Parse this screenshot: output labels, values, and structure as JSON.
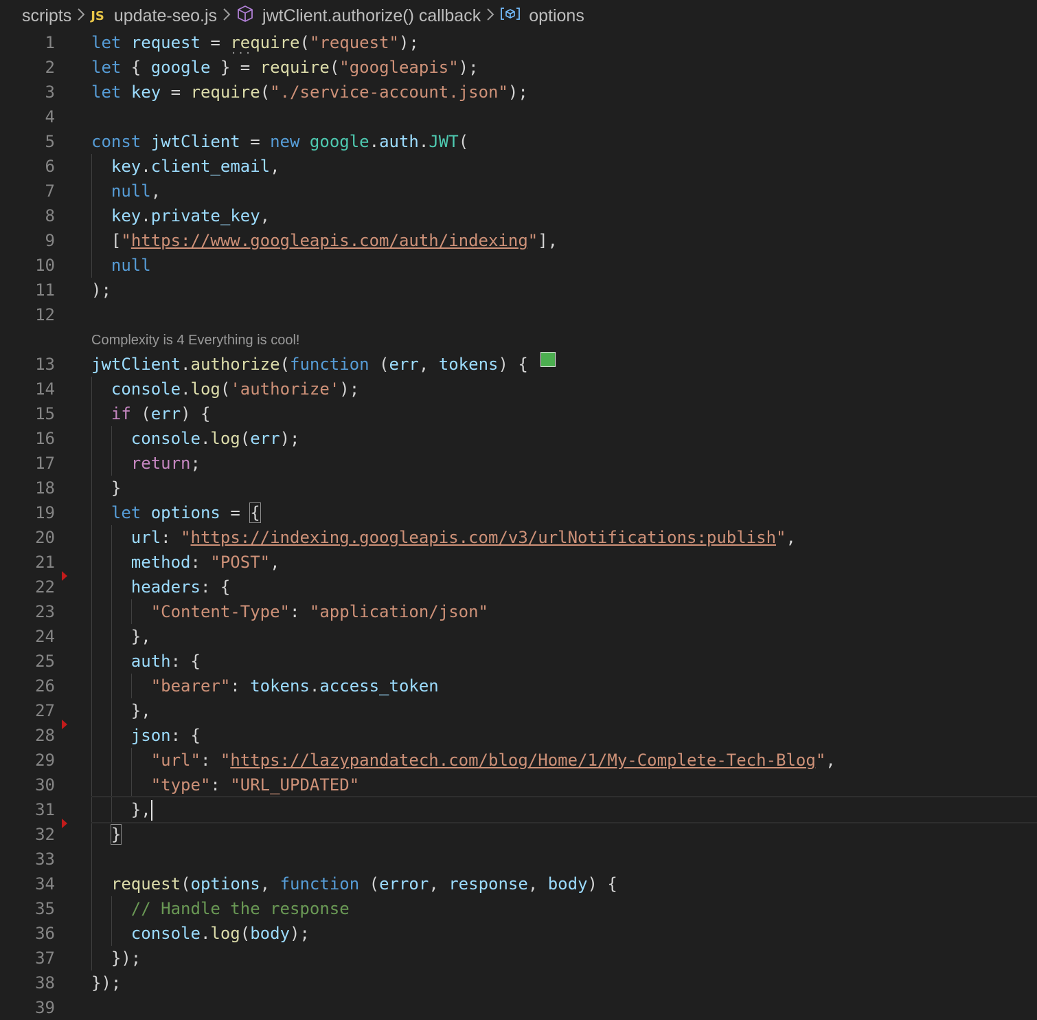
{
  "breadcrumb": {
    "folder": "scripts",
    "file": "update-seo.js",
    "file_icon": "JS",
    "scope": "jwtClient.authorize() callback",
    "symbol": "options"
  },
  "codelens": "Complexity is 4 Everything is cool!",
  "line_numbers": [
    "1",
    "2",
    "3",
    "4",
    "5",
    "6",
    "7",
    "8",
    "9",
    "10",
    "11",
    "12",
    "13",
    "14",
    "15",
    "16",
    "17",
    "18",
    "19",
    "20",
    "21",
    "22",
    "23",
    "24",
    "25",
    "26",
    "27",
    "28",
    "29",
    "30",
    "31",
    "32",
    "33",
    "34",
    "35",
    "36",
    "37",
    "38",
    "39"
  ],
  "colors": {
    "background": "#1f1f1f",
    "keyword": "#569cd6",
    "control": "#c586c0",
    "variable": "#9cdcfe",
    "function": "#dcdcaa",
    "class": "#4ec9b0",
    "string": "#ce9178",
    "comment": "#6a9955",
    "breakpoint_marker": "#c21b1b",
    "complexity_ok": "#4caf50"
  },
  "code": {
    "l1": [
      [
        "let",
        "kw"
      ],
      [
        " ",
        "pun"
      ],
      [
        "request",
        "var"
      ],
      [
        " = ",
        "pun"
      ],
      [
        "require",
        "fn"
      ],
      [
        "(",
        "pun"
      ],
      [
        "\"request\"",
        "str"
      ],
      [
        ");",
        "pun"
      ]
    ],
    "l2": [
      [
        "let",
        "kw"
      ],
      [
        " { ",
        "pun"
      ],
      [
        "google",
        "var"
      ],
      [
        " } = ",
        "pun"
      ],
      [
        "require",
        "fn"
      ],
      [
        "(",
        "pun"
      ],
      [
        "\"googleapis\"",
        "str"
      ],
      [
        ");",
        "pun"
      ]
    ],
    "l3": [
      [
        "let",
        "kw"
      ],
      [
        " ",
        "pun"
      ],
      [
        "key",
        "var"
      ],
      [
        " = ",
        "pun"
      ],
      [
        "require",
        "fn"
      ],
      [
        "(",
        "pun"
      ],
      [
        "\"./service-account.json\"",
        "str"
      ],
      [
        ");",
        "pun"
      ]
    ],
    "l4": [],
    "l5": [
      [
        "const",
        "kw"
      ],
      [
        " ",
        "pun"
      ],
      [
        "jwtClient",
        "var"
      ],
      [
        " = ",
        "pun"
      ],
      [
        "new",
        "kw"
      ],
      [
        " ",
        "pun"
      ],
      [
        "google",
        "cls"
      ],
      [
        ".",
        "pun"
      ],
      [
        "auth",
        "var"
      ],
      [
        ".",
        "pun"
      ],
      [
        "JWT",
        "cls"
      ],
      [
        "(",
        "pun"
      ]
    ],
    "l6": [
      [
        "  ",
        "pun"
      ],
      [
        "key",
        "var"
      ],
      [
        ".",
        "pun"
      ],
      [
        "client_email",
        "var"
      ],
      [
        ",",
        "pun"
      ]
    ],
    "l7": [
      [
        "  ",
        "pun"
      ],
      [
        "null",
        "kw"
      ],
      [
        ",",
        "pun"
      ]
    ],
    "l8": [
      [
        "  ",
        "pun"
      ],
      [
        "key",
        "var"
      ],
      [
        ".",
        "pun"
      ],
      [
        "private_key",
        "var"
      ],
      [
        ",",
        "pun"
      ]
    ],
    "l9": [
      [
        "  [",
        "pun"
      ],
      [
        "\"",
        "str"
      ],
      [
        "https://www.googleapis.com/auth/indexing",
        "url"
      ],
      [
        "\"",
        "str"
      ],
      [
        "],",
        "pun"
      ]
    ],
    "l10": [
      [
        "  ",
        "pun"
      ],
      [
        "null",
        "kw"
      ]
    ],
    "l11": [
      [
        ");",
        "pun"
      ]
    ],
    "l12": [],
    "l13": [
      [
        "jwtClient",
        "var"
      ],
      [
        ".",
        "pun"
      ],
      [
        "authorize",
        "fn"
      ],
      [
        "(",
        "pun"
      ],
      [
        "function",
        "kw"
      ],
      [
        " (",
        "pun"
      ],
      [
        "err",
        "var"
      ],
      [
        ", ",
        "pun"
      ],
      [
        "tokens",
        "var"
      ],
      [
        ") {",
        "pun"
      ]
    ],
    "l14": [
      [
        "  ",
        "pun"
      ],
      [
        "console",
        "var"
      ],
      [
        ".",
        "pun"
      ],
      [
        "log",
        "fn"
      ],
      [
        "(",
        "pun"
      ],
      [
        "'authorize'",
        "str"
      ],
      [
        ");",
        "pun"
      ]
    ],
    "l15": [
      [
        "  ",
        "pun"
      ],
      [
        "if",
        "ctl"
      ],
      [
        " (",
        "pun"
      ],
      [
        "err",
        "var"
      ],
      [
        ") {",
        "pun"
      ]
    ],
    "l16": [
      [
        "    ",
        "pun"
      ],
      [
        "console",
        "var"
      ],
      [
        ".",
        "pun"
      ],
      [
        "log",
        "fn"
      ],
      [
        "(",
        "pun"
      ],
      [
        "err",
        "var"
      ],
      [
        ");",
        "pun"
      ]
    ],
    "l17": [
      [
        "    ",
        "pun"
      ],
      [
        "return",
        "ctl"
      ],
      [
        ";",
        "pun"
      ]
    ],
    "l18": [
      [
        "  }",
        "pun"
      ]
    ],
    "l19": [
      [
        "  ",
        "pun"
      ],
      [
        "let",
        "kw"
      ],
      [
        " ",
        "pun"
      ],
      [
        "options",
        "var"
      ],
      [
        " = ",
        "pun"
      ]
    ],
    "l20": [
      [
        "    ",
        "pun"
      ],
      [
        "url",
        "var"
      ],
      [
        ": ",
        "pun"
      ],
      [
        "\"",
        "str"
      ],
      [
        "https://indexing.googleapis.com/v3/urlNotifications:publish",
        "url"
      ],
      [
        "\"",
        "str"
      ],
      [
        ",",
        "pun"
      ]
    ],
    "l21": [
      [
        "    ",
        "pun"
      ],
      [
        "method",
        "var"
      ],
      [
        ": ",
        "pun"
      ],
      [
        "\"POST\"",
        "str"
      ],
      [
        ",",
        "pun"
      ]
    ],
    "l22": [
      [
        "    ",
        "pun"
      ],
      [
        "headers",
        "var"
      ],
      [
        ": {",
        "pun"
      ]
    ],
    "l23": [
      [
        "      ",
        "pun"
      ],
      [
        "\"Content-Type\"",
        "str"
      ],
      [
        ": ",
        "pun"
      ],
      [
        "\"application/json\"",
        "str"
      ]
    ],
    "l24": [
      [
        "    },",
        "pun"
      ]
    ],
    "l25": [
      [
        "    ",
        "pun"
      ],
      [
        "auth",
        "var"
      ],
      [
        ": {",
        "pun"
      ]
    ],
    "l26": [
      [
        "      ",
        "pun"
      ],
      [
        "\"bearer\"",
        "str"
      ],
      [
        ": ",
        "pun"
      ],
      [
        "tokens",
        "var"
      ],
      [
        ".",
        "pun"
      ],
      [
        "access_token",
        "var"
      ]
    ],
    "l27": [
      [
        "    },",
        "pun"
      ]
    ],
    "l28": [
      [
        "    ",
        "pun"
      ],
      [
        "json",
        "var"
      ],
      [
        ": {",
        "pun"
      ]
    ],
    "l29": [
      [
        "      ",
        "pun"
      ],
      [
        "\"url\"",
        "str"
      ],
      [
        ": ",
        "pun"
      ],
      [
        "\"",
        "str"
      ],
      [
        "https://lazypandatech.com/blog/Home/1/My-Complete-Tech-Blog",
        "url"
      ],
      [
        "\"",
        "str"
      ],
      [
        ",",
        "pun"
      ]
    ],
    "l30": [
      [
        "      ",
        "pun"
      ],
      [
        "\"type\"",
        "str"
      ],
      [
        ": ",
        "pun"
      ],
      [
        "\"URL_UPDATED\"",
        "str"
      ]
    ],
    "l31": [
      [
        "    },",
        "pun"
      ]
    ],
    "l32": [
      [
        "  ",
        "pun"
      ]
    ],
    "l33": [],
    "l34": [
      [
        "  ",
        "pun"
      ],
      [
        "request",
        "fn"
      ],
      [
        "(",
        "pun"
      ],
      [
        "options",
        "var"
      ],
      [
        ", ",
        "pun"
      ],
      [
        "function",
        "kw"
      ],
      [
        " (",
        "pun"
      ],
      [
        "error",
        "var"
      ],
      [
        ", ",
        "pun"
      ],
      [
        "response",
        "var"
      ],
      [
        ", ",
        "pun"
      ],
      [
        "body",
        "var"
      ],
      [
        ") {",
        "pun"
      ]
    ],
    "l35": [
      [
        "    ",
        "pun"
      ],
      [
        "// Handle the response",
        "cmt"
      ]
    ],
    "l36": [
      [
        "    ",
        "pun"
      ],
      [
        "console",
        "var"
      ],
      [
        ".",
        "pun"
      ],
      [
        "log",
        "fn"
      ],
      [
        "(",
        "pun"
      ],
      [
        "body",
        "var"
      ],
      [
        ");",
        "pun"
      ]
    ],
    "l37": [
      [
        "  });",
        "pun"
      ]
    ],
    "l38": [
      [
        "});",
        "pun"
      ]
    ],
    "l39": []
  },
  "bracket_open": "{",
  "bracket_close": "}"
}
